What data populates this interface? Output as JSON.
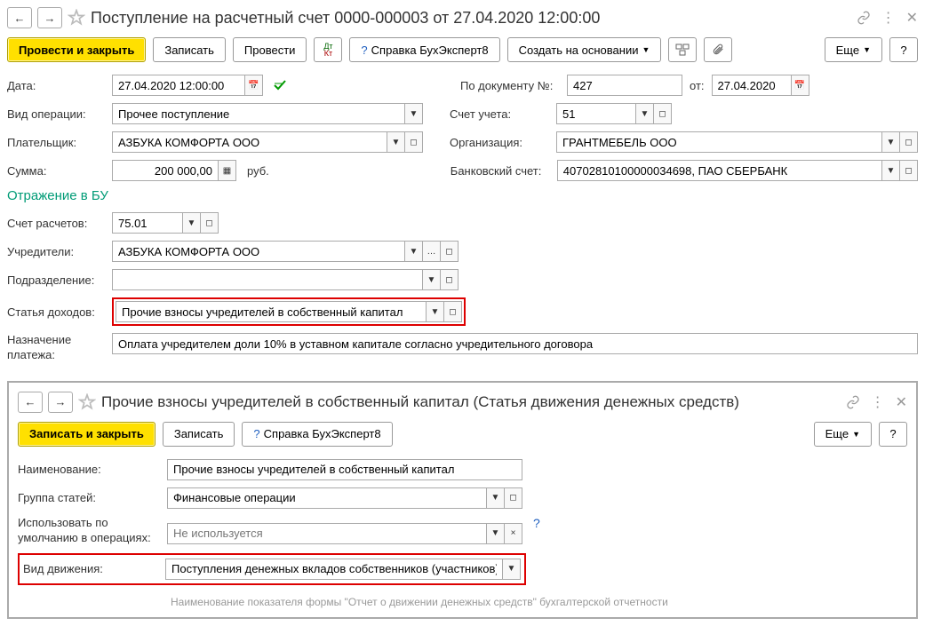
{
  "main": {
    "title": "Поступление на расчетный счет 0000-000003 от 27.04.2020 12:00:00",
    "toolbar": {
      "post_close": "Провести и закрыть",
      "save": "Записать",
      "post": "Провести",
      "help_ref": "Справка БухЭксперт8",
      "create_based": "Создать на основании",
      "more": "Еще"
    },
    "fields": {
      "date_label": "Дата:",
      "date_value": "27.04.2020 12:00:00",
      "doc_num_label": "По документу №:",
      "doc_num_value": "427",
      "from_label": "от:",
      "from_value": "27.04.2020",
      "op_type_label": "Вид операции:",
      "op_type_value": "Прочее поступление",
      "account_label": "Счет учета:",
      "account_value": "51",
      "payer_label": "Плательщик:",
      "payer_value": "АЗБУКА КОМФОРТА ООО",
      "org_label": "Организация:",
      "org_value": "ГРАНТМЕБЕЛЬ ООО",
      "amount_label": "Сумма:",
      "amount_value": "200 000,00",
      "currency": "руб.",
      "bank_acc_label": "Банковский счет:",
      "bank_acc_value": "40702810100000034698, ПАО СБЕРБАНК"
    },
    "section": "Отражение в БУ",
    "bu": {
      "settle_acc_label": "Счет расчетов:",
      "settle_acc_value": "75.01",
      "founders_label": "Учредители:",
      "founders_value": "АЗБУКА КОМФОРТА ООО",
      "dept_label": "Подразделение:",
      "dept_value": "",
      "income_item_label": "Статья доходов:",
      "income_item_value": "Прочие взносы учредителей в собственный капитал",
      "purpose_label": "Назначение платежа:",
      "purpose_value": "Оплата учредителем доли 10% в уставном капитале согласно учредительного договора"
    }
  },
  "sub": {
    "title": "Прочие взносы учредителей в собственный капитал (Статья движения денежных средств)",
    "toolbar": {
      "save_close": "Записать и закрыть",
      "save": "Записать",
      "help_ref": "Справка БухЭксперт8",
      "more": "Еще"
    },
    "fields": {
      "name_label": "Наименование:",
      "name_value": "Прочие взносы учредителей в собственный капитал",
      "group_label": "Группа статей:",
      "group_value": "Финансовые операции",
      "use_default_label1": "Использовать по",
      "use_default_label2": "умолчанию в операциях:",
      "use_default_value": "Не используется",
      "move_type_label": "Вид движения:",
      "move_type_value": "Поступления денежных вкладов собственников (участников)",
      "hint": "Наименование показателя формы \"Отчет о движении денежных средств\" бухгалтерской отчетности"
    }
  }
}
